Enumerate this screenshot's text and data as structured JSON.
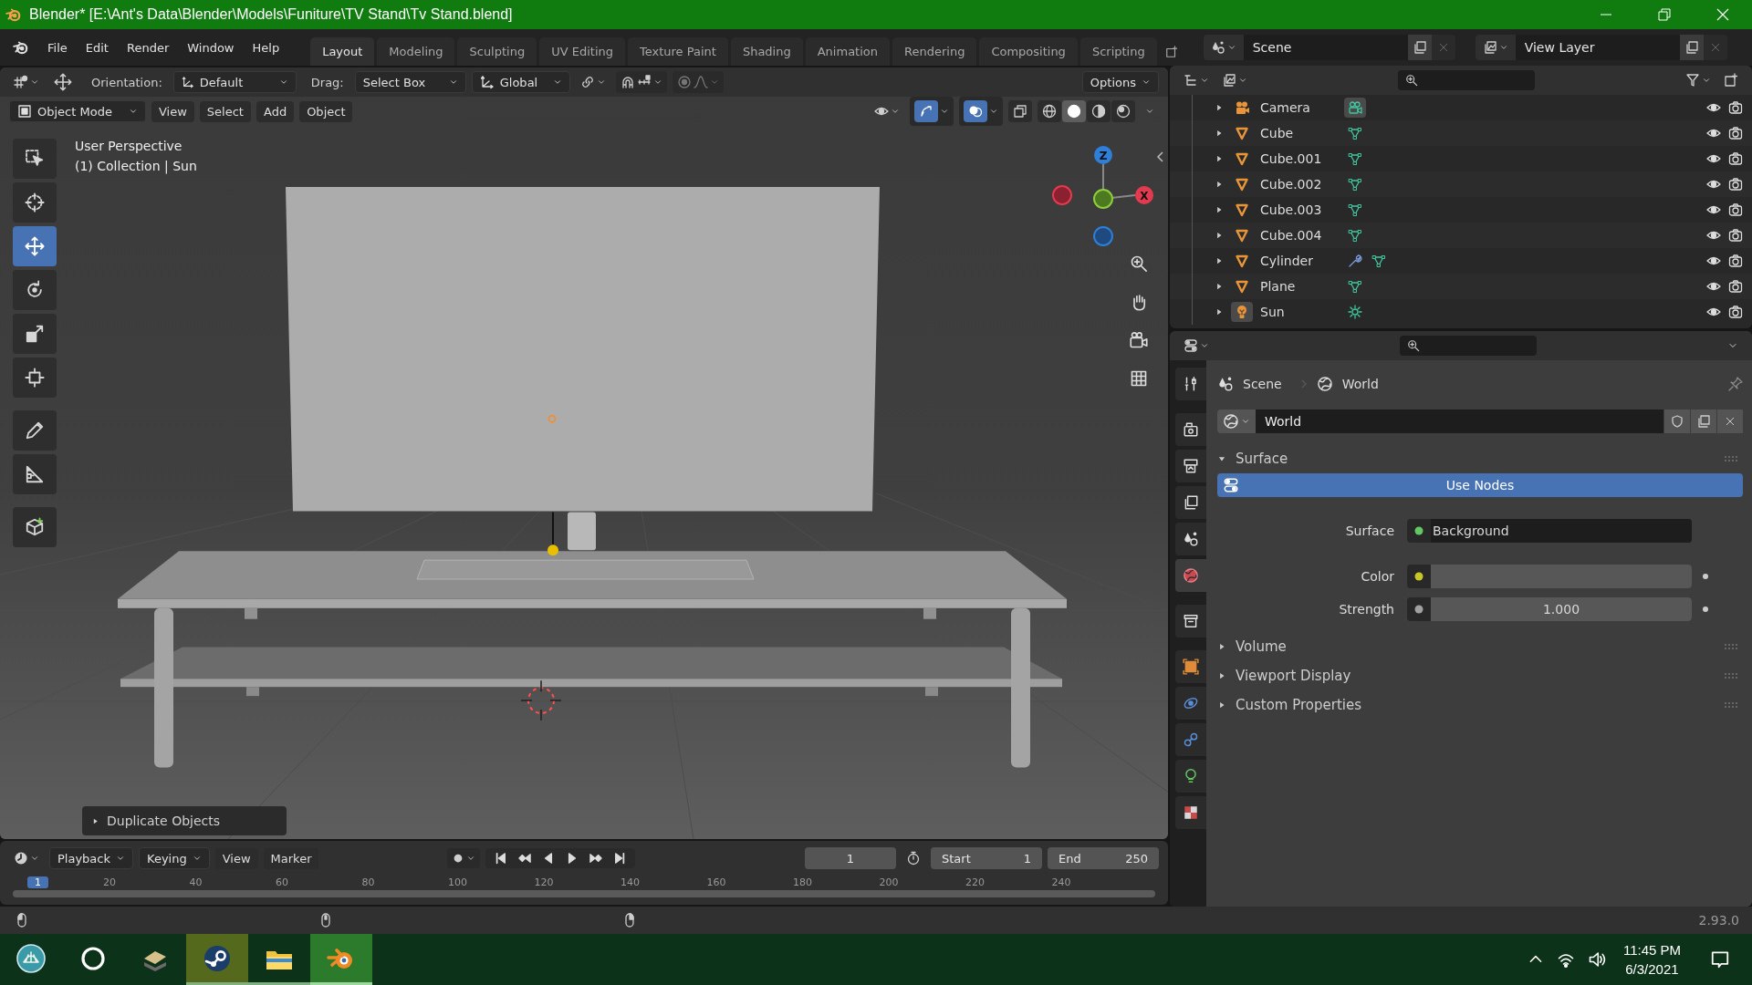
{
  "window": {
    "title": "Blender* [E:\\Ant's Data\\Blender\\Models\\Funiture\\TV Stand\\Tv Stand.blend]"
  },
  "menu": [
    "File",
    "Edit",
    "Render",
    "Window",
    "Help"
  ],
  "workspaces": [
    {
      "label": "Layout",
      "selected": true
    },
    {
      "label": "Modeling",
      "selected": false
    },
    {
      "label": "Sculpting",
      "selected": false
    },
    {
      "label": "UV Editing",
      "selected": false
    },
    {
      "label": "Texture Paint",
      "selected": false
    },
    {
      "label": "Shading",
      "selected": false
    },
    {
      "label": "Animation",
      "selected": false
    },
    {
      "label": "Rendering",
      "selected": false
    },
    {
      "label": "Compositing",
      "selected": false
    },
    {
      "label": "Scripting",
      "selected": false
    }
  ],
  "scene_selector": {
    "name": "Scene"
  },
  "view_layer_selector": {
    "name": "View Layer"
  },
  "tool_settings": {
    "orientation_label": "Orientation:",
    "orientation": "Default",
    "drag_label": "Drag:",
    "drag": "Select Box",
    "transform_orientation": "Global",
    "options": "Options"
  },
  "viewport_header": {
    "mode": "Object Mode",
    "menus": [
      "View",
      "Select",
      "Add",
      "Object"
    ],
    "gizmos_on": true,
    "overlays_on": true,
    "xray": false,
    "shading": [
      {
        "kind": "wireframe",
        "selected": false
      },
      {
        "kind": "solid",
        "selected": true
      },
      {
        "kind": "material",
        "selected": false
      },
      {
        "kind": "rendered",
        "selected": false
      }
    ]
  },
  "viewport": {
    "view_name": "User Perspective",
    "context": "(1) Collection | Sun",
    "last_operator": "Duplicate Objects",
    "gizmo_axes": [
      {
        "label": "Z",
        "color": "#2f7fd8"
      },
      {
        "label": "X",
        "color": "#e33a4f"
      }
    ]
  },
  "tools": [
    {
      "kind": "select-box",
      "selected": false
    },
    {
      "kind": "cursor",
      "selected": false
    },
    {
      "kind": "move",
      "selected": true
    },
    {
      "kind": "rotate",
      "selected": false
    },
    {
      "kind": "scale",
      "selected": false
    },
    {
      "kind": "transform",
      "selected": false
    },
    {
      "kind": "annotate",
      "selected": false
    },
    {
      "kind": "measure",
      "selected": false
    },
    {
      "kind": "add-cube",
      "selected": false
    }
  ],
  "outliner": {
    "items": [
      {
        "name": "Camera",
        "kind": "camera",
        "active": false,
        "data_active": true,
        "modifier": false
      },
      {
        "name": "Cube",
        "kind": "mesh",
        "active": false,
        "data_active": false,
        "modifier": false
      },
      {
        "name": "Cube.001",
        "kind": "mesh",
        "active": false,
        "data_active": false,
        "modifier": false
      },
      {
        "name": "Cube.002",
        "kind": "mesh",
        "active": false,
        "data_active": false,
        "modifier": false
      },
      {
        "name": "Cube.003",
        "kind": "mesh",
        "active": false,
        "data_active": false,
        "modifier": false
      },
      {
        "name": "Cube.004",
        "kind": "mesh",
        "active": false,
        "data_active": false,
        "modifier": false
      },
      {
        "name": "Cylinder",
        "kind": "mesh",
        "active": false,
        "data_active": false,
        "modifier": true
      },
      {
        "name": "Plane",
        "kind": "mesh",
        "active": false,
        "data_active": false,
        "modifier": false
      },
      {
        "name": "Sun",
        "kind": "light",
        "active": true,
        "data_active": false,
        "modifier": false
      }
    ]
  },
  "properties": {
    "tabs": [
      {
        "kind": "tool",
        "selected": false
      },
      {
        "kind": "render",
        "selected": false
      },
      {
        "kind": "output",
        "selected": false
      },
      {
        "kind": "view-layer",
        "selected": false
      },
      {
        "kind": "scene",
        "selected": false
      },
      {
        "kind": "world",
        "selected": true
      },
      {
        "kind": "collection",
        "selected": false
      },
      {
        "kind": "object",
        "selected": false
      },
      {
        "kind": "physics",
        "selected": false
      },
      {
        "kind": "constraint",
        "selected": false
      },
      {
        "kind": "light-data",
        "selected": false
      },
      {
        "kind": "texture",
        "selected": false
      }
    ],
    "breadcrumb": [
      {
        "kind": "scene",
        "label": "Scene"
      },
      {
        "kind": "world",
        "label": "World"
      }
    ],
    "datablock": "World",
    "use_nodes": {
      "label": "Use Nodes",
      "on": true
    },
    "panels": [
      {
        "title": "Surface",
        "expanded": true
      },
      {
        "title": "Volume",
        "expanded": false
      },
      {
        "title": "Viewport Display",
        "expanded": false
      },
      {
        "title": "Custom Properties",
        "expanded": false
      }
    ],
    "inputs": [
      {
        "label": "Surface",
        "kind": "shader",
        "value": "Background",
        "color": "#63c763"
      },
      {
        "label": "Color",
        "kind": "color",
        "color": "#c7c729"
      },
      {
        "label": "Strength",
        "kind": "number",
        "value": "1.000",
        "color": "#a1a1a1"
      }
    ]
  },
  "timeline": {
    "menus": [
      "Playback",
      "Keying",
      "View",
      "Marker"
    ],
    "current_frame": "1",
    "start_label": "Start",
    "start": "1",
    "end_label": "End",
    "end": "250",
    "playhead": "1",
    "ruler": [
      "20",
      "40",
      "60",
      "80",
      "100",
      "120",
      "140",
      "160",
      "180",
      "200",
      "220",
      "240"
    ]
  },
  "status_bar": {
    "version": "2.93.0"
  },
  "taskbar": {
    "apps": [
      {
        "kind": "start",
        "running": false,
        "flashing": false,
        "active": false
      },
      {
        "kind": "search",
        "running": false,
        "flashing": false,
        "active": false
      },
      {
        "kind": "app",
        "running": false,
        "flashing": false,
        "active": false
      },
      {
        "kind": "steam",
        "running": true,
        "flashing": true,
        "active": false
      },
      {
        "kind": "files",
        "running": true,
        "flashing": false,
        "active": false
      },
      {
        "kind": "blender",
        "running": true,
        "flashing": false,
        "active": true
      }
    ],
    "time": "11:45 PM",
    "date": "6/3/2021"
  }
}
